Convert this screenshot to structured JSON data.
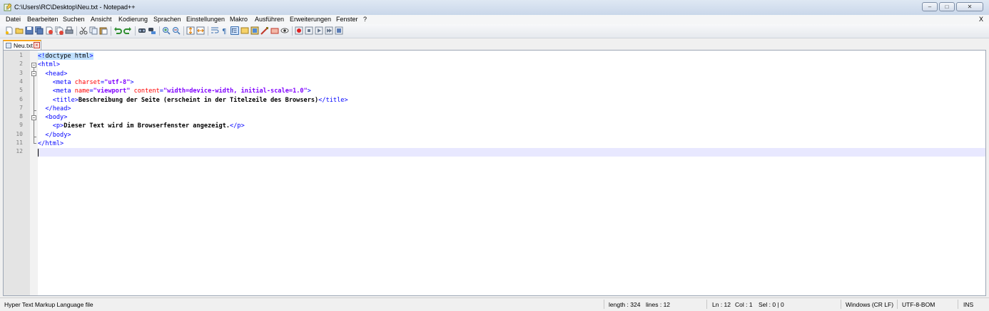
{
  "window": {
    "title": "C:\\Users\\RC\\Desktop\\Neu.txt - Notepad++",
    "minimize_glyph": "–",
    "maximize_glyph": "□",
    "close_glyph": "✕"
  },
  "menu": {
    "items": [
      "Datei",
      "Bearbeiten",
      "Suchen",
      "Ansicht",
      "Kodierung",
      "Sprachen",
      "Einstellungen",
      "Makro",
      "Ausführen",
      "Erweiterungen",
      "Fenster",
      "?"
    ],
    "close_label": "X"
  },
  "toolbar": {
    "icons": [
      "new-file-icon",
      "open-file-icon",
      "save-icon",
      "save-all-icon",
      "close-icon",
      "close-all-icon",
      "print-icon",
      "cut-icon",
      "copy-icon",
      "paste-icon",
      "undo-icon",
      "redo-icon",
      "find-icon",
      "replace-icon",
      "zoom-in-icon",
      "zoom-out-icon",
      "sync-vertical-icon",
      "sync-horizontal-icon",
      "word-wrap-icon",
      "show-all-chars-icon",
      "indent-guide-icon",
      "user-language-icon",
      "doc-map-icon",
      "function-list-icon",
      "folder-workspace-icon",
      "monitoring-icon",
      "record-macro-icon",
      "stop-record-icon",
      "play-macro-icon",
      "play-multiple-icon",
      "save-macro-icon"
    ]
  },
  "tab": {
    "label": "Neu.txt",
    "close_glyph": "×"
  },
  "editor": {
    "line_numbers": [
      "1",
      "2",
      "3",
      "4",
      "5",
      "6",
      "7",
      "8",
      "9",
      "10",
      "11",
      "12"
    ],
    "lines": [
      [
        {
          "t": "<!",
          "c": "hl tag"
        },
        {
          "t": "doctype html",
          "c": "hl doct"
        },
        {
          "t": ">",
          "c": "hl tag"
        }
      ],
      [
        {
          "t": "<html>",
          "c": "tag"
        }
      ],
      [
        {
          "t": "  <head>",
          "c": "tag"
        }
      ],
      [
        {
          "t": "    <meta ",
          "c": "tag"
        },
        {
          "t": "charset",
          "c": "attr"
        },
        {
          "t": "=",
          "c": "tag"
        },
        {
          "t": "\"utf-8\"",
          "c": "val"
        },
        {
          "t": ">",
          "c": "tag"
        }
      ],
      [
        {
          "t": "    <meta ",
          "c": "tag"
        },
        {
          "t": "name",
          "c": "attr"
        },
        {
          "t": "=",
          "c": "tag"
        },
        {
          "t": "\"viewport\"",
          "c": "val"
        },
        {
          "t": " ",
          "c": "tag"
        },
        {
          "t": "content",
          "c": "attr"
        },
        {
          "t": "=",
          "c": "tag"
        },
        {
          "t": "\"width=device-width, initial-scale=1.0\"",
          "c": "val"
        },
        {
          "t": ">",
          "c": "tag"
        }
      ],
      [
        {
          "t": "    <title>",
          "c": "tag"
        },
        {
          "t": "Beschreibung der Seite (erscheint in der Titelzeile des Browsers)",
          "c": "txt"
        },
        {
          "t": "</title>",
          "c": "tag"
        }
      ],
      [
        {
          "t": "  </head>",
          "c": "tag"
        }
      ],
      [
        {
          "t": "  <body>",
          "c": "tag"
        }
      ],
      [
        {
          "t": "    <p>",
          "c": "tag"
        },
        {
          "t": "Dieser Text wird im Browserfenster angezeigt.",
          "c": "txt"
        },
        {
          "t": "</p>",
          "c": "tag"
        }
      ],
      [
        {
          "t": "  </body>",
          "c": "tag"
        }
      ],
      [
        {
          "t": "</html>",
          "c": "tag"
        }
      ],
      []
    ],
    "current_line": 12
  },
  "status": {
    "file_type": "Hyper Text Markup Language file",
    "length": "length : 324",
    "lines": "lines : 12",
    "ln": "Ln : 12",
    "col": "Col : 1",
    "sel": "Sel : 0 | 0",
    "eol": "Windows (CR LF)",
    "encoding": "UTF-8-BOM",
    "mode": "INS"
  },
  "colors": {
    "tag": "#0000ff",
    "attribute": "#ff0000",
    "attribute_value": "#8000ff",
    "current_line": "#e8e8ff",
    "tab_accent": "#f7a51c"
  }
}
